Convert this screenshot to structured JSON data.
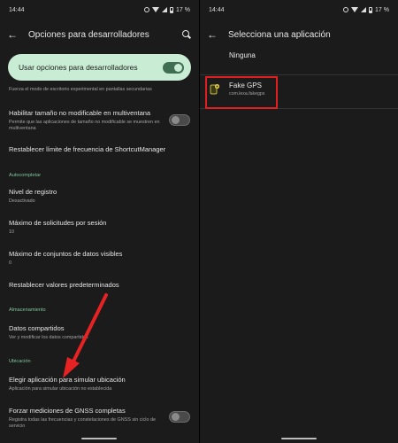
{
  "colors": {
    "accent": "#7ec79a",
    "pill": "#c9ecd4",
    "arrow": "#e62222",
    "highlight": "#e02020"
  },
  "left": {
    "status": {
      "time": "14:44",
      "battery": "17 %"
    },
    "title": "Opciones para desarrolladores",
    "master": {
      "label": "Usar opciones para desarrolladores",
      "on": true
    },
    "partial_text": "Fuerza el modo de escritorio experimental en pantallas secundarias",
    "items": [
      {
        "title": "Habilitar tamaño no modificable en multiventana",
        "subtitle": "Permite que las aplicaciones de tamaño no modificable se muestren en multiventana",
        "toggle": false
      },
      {
        "title": "Restablecer límite de frecuencia de ShortcutManager"
      }
    ],
    "sections": {
      "autocomplete": "Autocompletar",
      "storage": "Almacenamiento",
      "location": "Ubicación"
    },
    "autocomplete_items": [
      {
        "title": "Nivel de registro",
        "subtitle": "Desactivado"
      },
      {
        "title": "Máximo de solicitudes por sesión",
        "subtitle": "10"
      },
      {
        "title": "Máximo de conjuntos de datos visibles",
        "subtitle": "0"
      },
      {
        "title": "Restablecer valores predeterminados"
      }
    ],
    "storage_item": {
      "title": "Datos compartidos",
      "subtitle": "Ver y modificar los datos compartidos"
    },
    "location_items": [
      {
        "title": "Elegir aplicación para simular ubicación",
        "subtitle": "Aplicación para simular ubicación no establecida"
      },
      {
        "title": "Forzar mediciones de GNSS completas",
        "subtitle": "Registra todas las frecuencias y constelaciones de GNSS sin ciclo de servicio",
        "toggle": false
      }
    ]
  },
  "right": {
    "status": {
      "time": "14:44",
      "battery": "17 %"
    },
    "title": "Selecciona una aplicación",
    "none_option": "Ninguna",
    "app": {
      "name": "Fake GPS",
      "package": "com.lexa.fakegps",
      "icon": "gps-pin-icon"
    }
  }
}
